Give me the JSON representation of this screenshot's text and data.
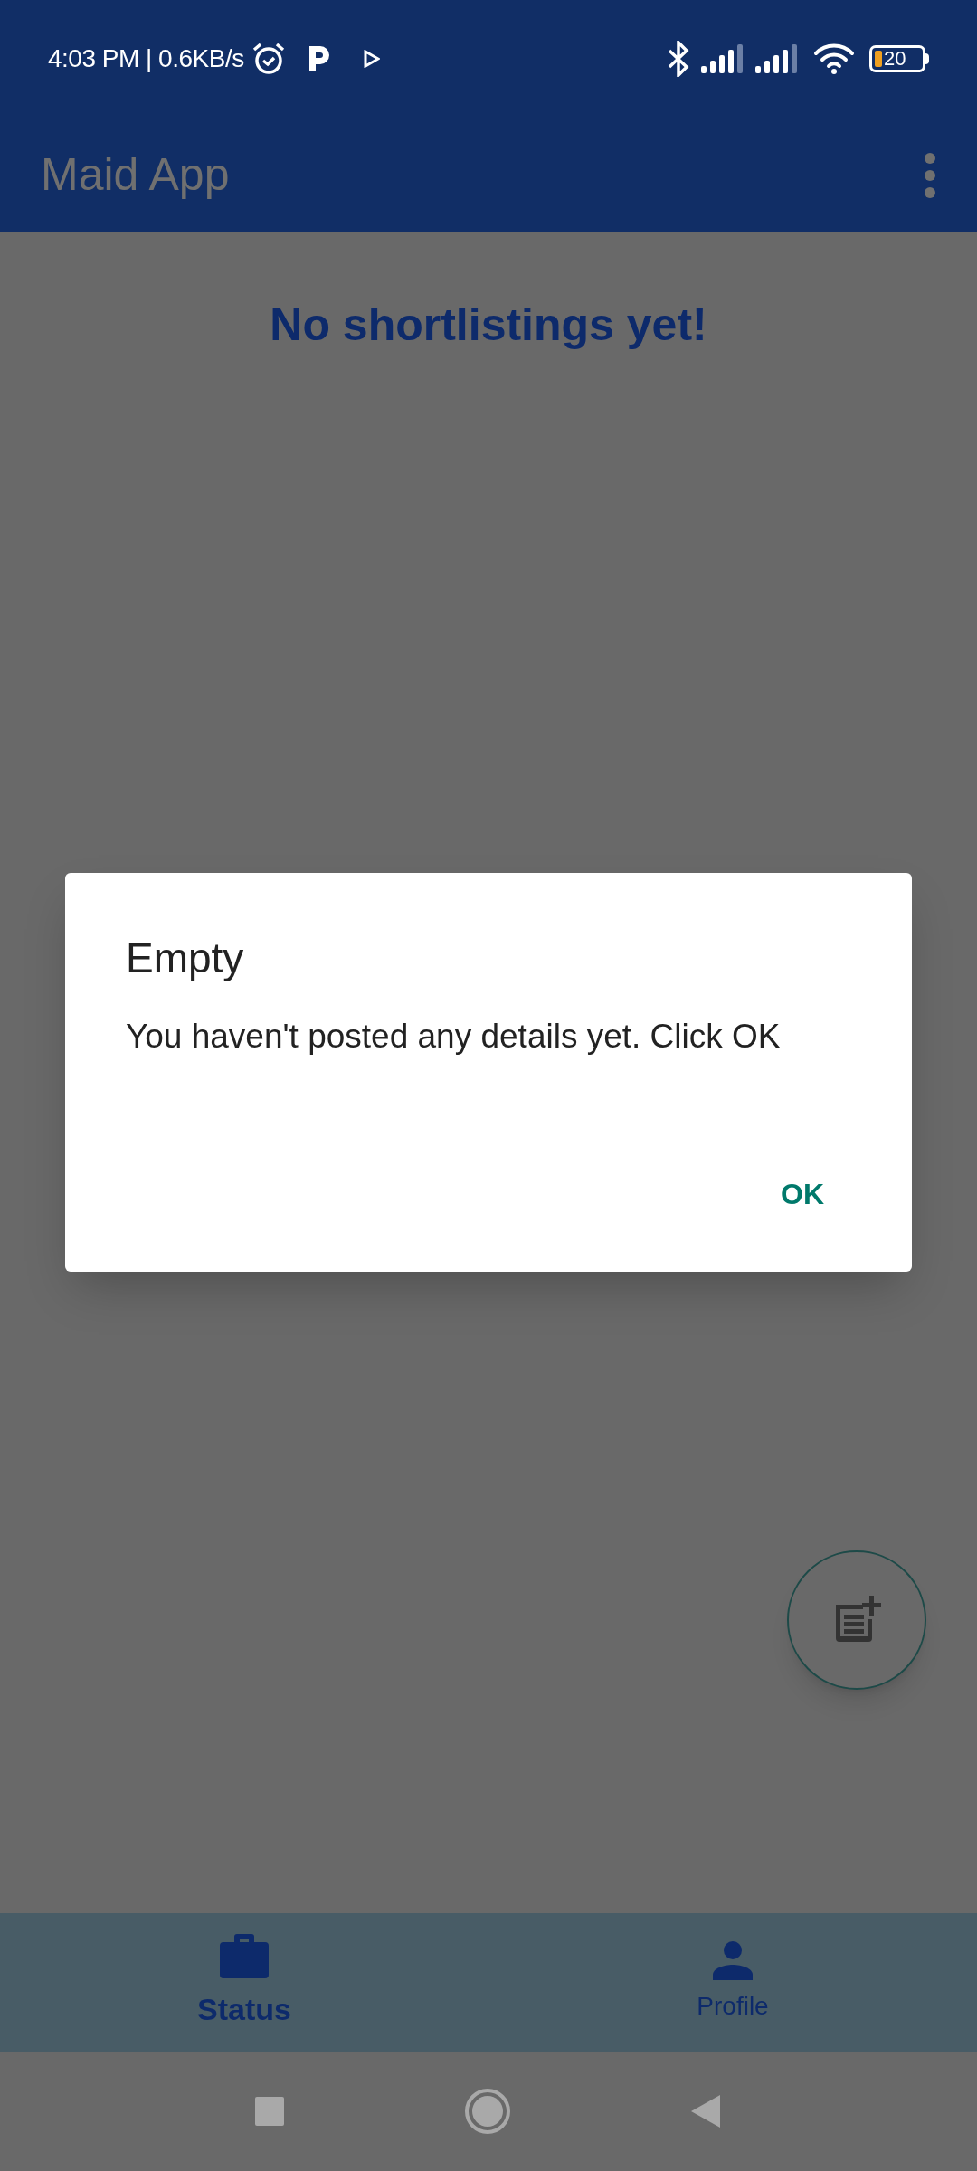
{
  "status_bar": {
    "time": "4:03 PM | 0.6KB/s",
    "battery": "20"
  },
  "app_bar": {
    "title": "Maid App"
  },
  "content": {
    "message": "No shortlistings yet!"
  },
  "dialog": {
    "title": "Empty",
    "message": "You haven't posted any details yet. Click OK",
    "buttons": [
      "OK"
    ]
  },
  "bottom_nav": [
    {
      "label": "Status",
      "kind": "briefcase",
      "selected": true
    },
    {
      "label": "Profile",
      "kind": "person",
      "selected": false
    }
  ]
}
